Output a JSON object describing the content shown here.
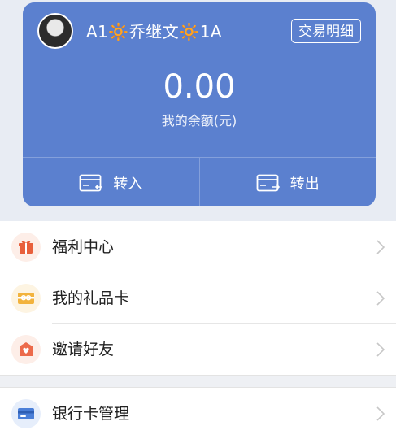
{
  "account": {
    "username": "A1🔆乔继文🔆1A",
    "detail_button": "交易明细",
    "balance": "0.00",
    "balance_label": "我的余额(元)",
    "transfer_in": "转入",
    "transfer_out": "转出"
  },
  "menu": {
    "items": [
      {
        "label": "福利中心",
        "icon": "gift-icon",
        "color": "#e8603c"
      },
      {
        "label": "我的礼品卡",
        "icon": "gift-card-icon",
        "color": "#f2b33d"
      },
      {
        "label": "邀请好友",
        "icon": "invite-icon",
        "color": "#ec6a4a"
      },
      {
        "label": "银行卡管理",
        "icon": "bank-card-icon",
        "color": "#4a7fd8"
      }
    ]
  },
  "colors": {
    "card_background": "#5b80cf",
    "page_background": "#e8ecf3"
  }
}
